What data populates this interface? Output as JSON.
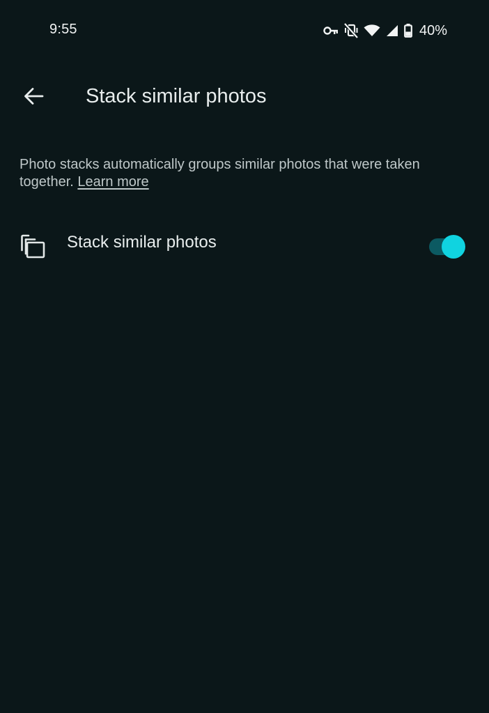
{
  "status_bar": {
    "time": "9:55",
    "battery_percent": "40%",
    "icons": [
      "vpn-key-icon",
      "vibrate-off-icon",
      "wifi-icon",
      "cell-signal-icon",
      "battery-icon"
    ]
  },
  "app_bar": {
    "back_icon": "arrow-back-icon",
    "title": "Stack similar photos"
  },
  "description": {
    "text": "Photo stacks automatically groups similar photos that were taken together. ",
    "link_label": "Learn more"
  },
  "setting": {
    "icon": "stack-icon",
    "label": "Stack similar photos",
    "enabled": true
  },
  "colors": {
    "background": "#0b1719",
    "accent": "#10d3e0",
    "track": "#0c5a62"
  }
}
